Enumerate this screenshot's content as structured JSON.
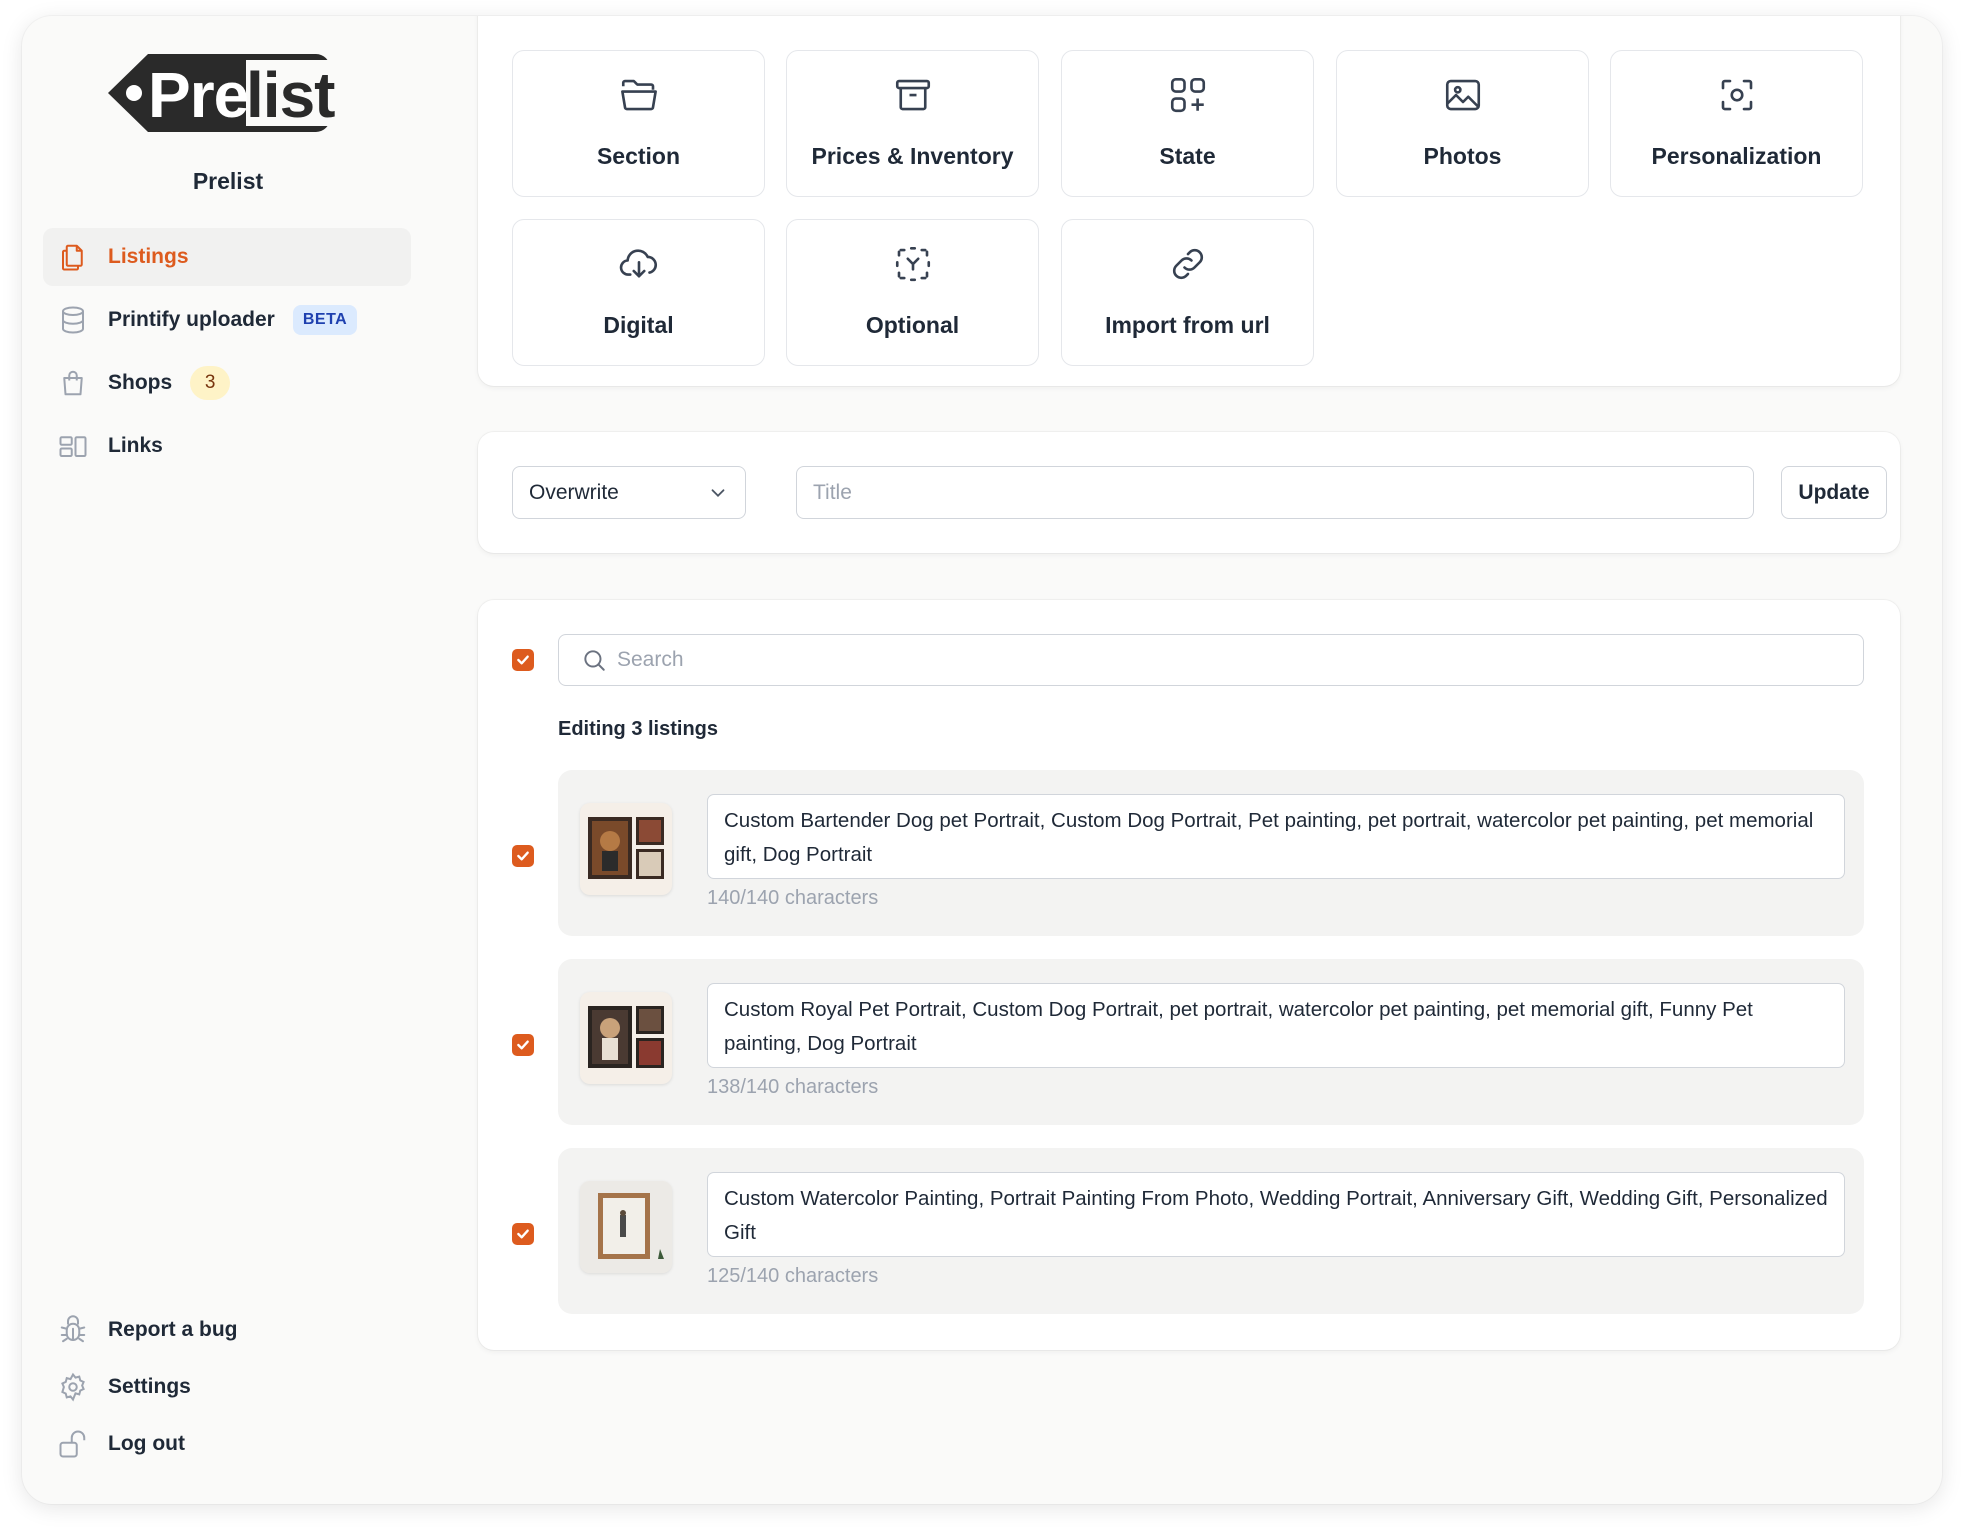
{
  "brand": {
    "logo_text": "Prelist",
    "name": "Prelist"
  },
  "sidebar": {
    "items": [
      {
        "label": "Listings",
        "icon": "documents-icon",
        "active": true
      },
      {
        "label": "Printify uploader",
        "icon": "database-icon",
        "badge": "BETA"
      },
      {
        "label": "Shops",
        "icon": "shopping-bag-icon",
        "count": "3"
      },
      {
        "label": "Links",
        "icon": "links-icon"
      }
    ],
    "bottom": [
      {
        "label": "Report a bug",
        "icon": "bug-icon"
      },
      {
        "label": "Settings",
        "icon": "gear-icon"
      },
      {
        "label": "Log out",
        "icon": "unlock-icon"
      }
    ]
  },
  "actions": [
    {
      "label": "Section",
      "icon": "folder-icon"
    },
    {
      "label": "Prices & Inventory",
      "icon": "archive-icon"
    },
    {
      "label": "State",
      "icon": "apps-plus-icon"
    },
    {
      "label": "Photos",
      "icon": "image-icon"
    },
    {
      "label": "Personalization",
      "icon": "scan-face-icon"
    },
    {
      "label": "Digital",
      "icon": "cloud-download-icon"
    },
    {
      "label": "Optional",
      "icon": "dashed-box-icon"
    },
    {
      "label": "Import from url",
      "icon": "link-icon"
    }
  ],
  "update": {
    "mode": "Overwrite",
    "title_placeholder": "Title",
    "button": "Update"
  },
  "list": {
    "search_placeholder": "Search",
    "editing_label": "Editing 3 listings",
    "select_all_checked": true,
    "listings": [
      {
        "title": "Custom Bartender Dog pet Portrait, Custom Dog Portrait, Pet painting, pet portrait, watercolor pet painting, pet memorial gift, Dog Portrait",
        "count": "140/140 characters",
        "checked": true
      },
      {
        "title": "Custom Royal Pet Portrait, Custom Dog Portrait, pet portrait, watercolor pet painting, pet memorial gift, Funny Pet painting, Dog Portrait",
        "count": "138/140 characters",
        "checked": true
      },
      {
        "title": "Custom Watercolor Painting, Portrait Painting From Photo, Wedding Portrait, Anniversary Gift, Wedding Gift, Personalized Gift",
        "count": "125/140 characters",
        "checked": true
      }
    ]
  },
  "colors": {
    "accent": "#dd5b1e",
    "beta_bg": "#dbeafe",
    "count_bg": "#fef3c7"
  }
}
